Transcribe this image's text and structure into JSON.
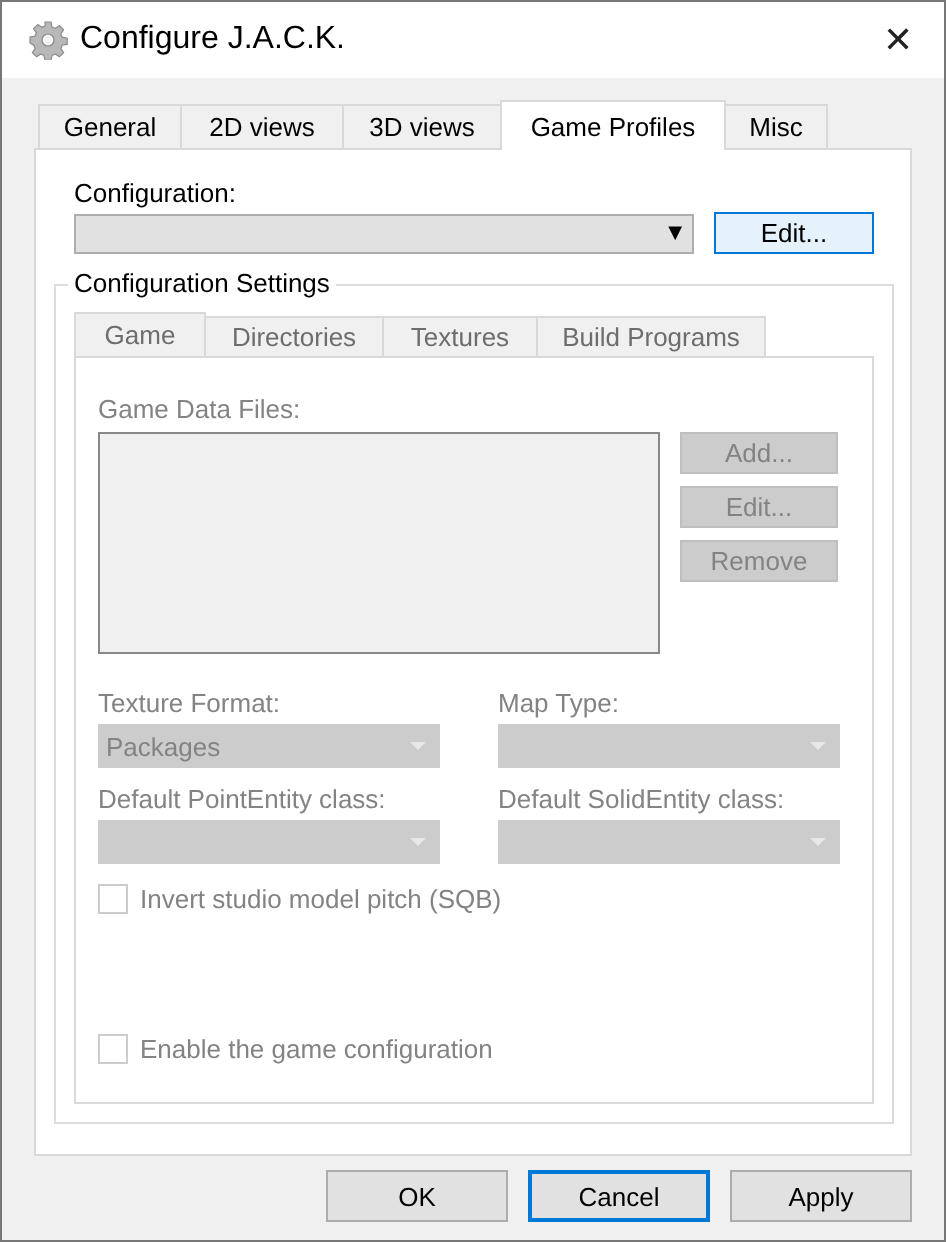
{
  "window": {
    "title": "Configure J.A.C.K.",
    "close": "✕"
  },
  "tabs": [
    {
      "label": "General",
      "selected": false
    },
    {
      "label": "2D views",
      "selected": false
    },
    {
      "label": "3D views",
      "selected": false
    },
    {
      "label": "Game Profiles",
      "selected": true
    },
    {
      "label": "Misc",
      "selected": false
    }
  ],
  "configuration": {
    "label": "Configuration:",
    "value_arrow": "▼",
    "edit_button": {
      "label": "Edit...",
      "focused": true
    }
  },
  "settings": {
    "title": "Configuration Settings",
    "tabs": [
      {
        "label": "Game",
        "selected": true
      },
      {
        "label": "Directories",
        "selected": false
      },
      {
        "label": "Textures",
        "selected": false
      },
      {
        "label": "Build Programs",
        "selected": false
      }
    ],
    "data_files": {
      "label": "Game Data Files:",
      "disabled": true
    },
    "file_buttons": [
      {
        "label": "Add...",
        "disabled": true
      },
      {
        "label": "Edit...",
        "disabled": true
      },
      {
        "label": "Remove",
        "disabled": true
      }
    ],
    "dropdowns": [
      {
        "label": "Texture Format:",
        "value": "Packages",
        "disabled": true
      },
      {
        "label": "Map Type:",
        "disabled": true
      },
      {
        "label": "Default PointEntity class:",
        "disabled": true
      },
      {
        "label": "Default SolidEntity class:",
        "disabled": true
      }
    ],
    "invert_pitch": {
      "label": "Invert studio model pitch (SQB)",
      "checked": false,
      "disabled": true
    },
    "enable_game": {
      "label": "Enable the game configuration",
      "checked": false,
      "disabled": true
    }
  },
  "buttons": [
    {
      "label": "OK",
      "focused": false
    },
    {
      "label": "Cancel",
      "focused": true
    },
    {
      "label": "Apply",
      "focused": false
    }
  ]
}
